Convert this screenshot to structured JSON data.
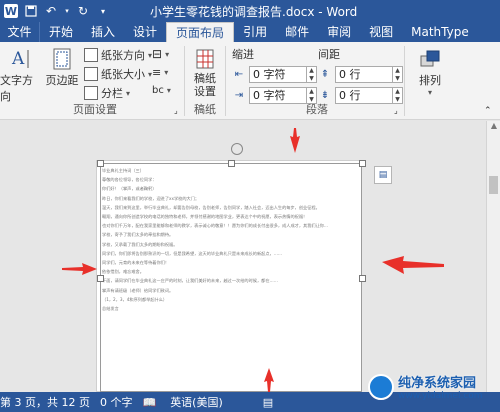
{
  "window": {
    "title": "小学生零花钱的调查报告.docx - Word"
  },
  "tabs": [
    "文件",
    "开始",
    "插入",
    "设计",
    "页面布局",
    "引用",
    "邮件",
    "审阅",
    "视图",
    "MathType"
  ],
  "active_tab": "页面布局",
  "ribbon": {
    "page_setup": {
      "text_direction": "文字方向",
      "margins": "页边距",
      "orientation": "纸张方向",
      "size": "纸张大小",
      "columns": "分栏",
      "group_label": "页面设置"
    },
    "manuscript": {
      "button": "稿纸设置",
      "group_label": "稿纸"
    },
    "paragraph": {
      "indent_head": "缩进",
      "spacing_head": "间距",
      "indent_left": "0 字符",
      "indent_right": "0 字符",
      "space_before": "0 行",
      "space_after": "0 行",
      "group_label": "段落"
    },
    "arrange": {
      "button": "排列"
    }
  },
  "document": {
    "lines": [
      "毕业典礼主持词（三）",
      "尊敬的各位领导，各位同学：",
      "你们好！（掌声，或者鞠躬）",
      "昨日，你们来看我们的学校，迎进了xx学校的大门；",
      "温天，我们来到这里，举行毕业典礼，却要告别母校，告别老师，告别同学，踏入社会，迈出人生的每步，创业征程。",
      "翱翔，通向你所创造学校的电话的独特和老师，并领付感谢的地图学业，更表达个中的祝愿，表示热情的祝福！",
      "也对你们千万年，配在我家里能够和老师的教学，表示诚心的敬意！！愿为你们的成长付出很多，成人成才，其我们让你...",
      "学校，寄予了我们太多的牵挂和期待。",
      "学校，又承载了我们太多的期盼和祝福。",
      "同学们，你们即将告别那熟识的一切，但是我希望，这天的毕业典礼只是未来成长的新起点，……",
      "同学们，元育的未来在等待着你们！",
      "依依惜别，难忘难舍。",
      "下面，请同学们在毕业典礼这一庄严的时刻，让我们美好的未来，越过一次给的时候，都在……",
      "掌声有请班级（老师）给同学们致词。",
      "（1，2，3，4和序列都举起什么）",
      "总结发言"
    ]
  },
  "status": {
    "page": "第 3 页，共 12 页",
    "words": "0 个字",
    "language": "英语(美国)"
  },
  "watermark": {
    "line1": "纯净系统家园",
    "line2": "www.yidaimei.com"
  },
  "colors": {
    "accent": "#2b579a",
    "annotation_arrow": "#e8302a"
  }
}
